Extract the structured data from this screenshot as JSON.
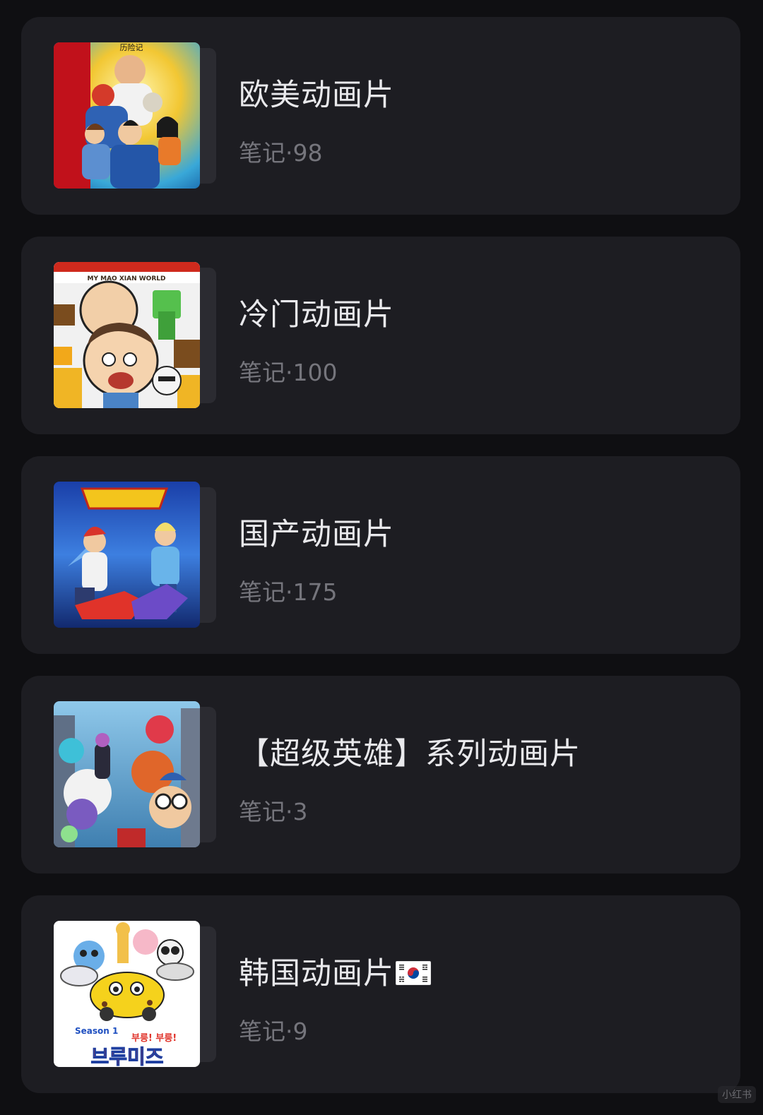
{
  "collections": [
    {
      "title": "欧美动画片",
      "count": "笔记·98",
      "cover_alt": "cover-western"
    },
    {
      "title": "冷门动画片",
      "count": "笔记·100",
      "cover_alt": "cover-niche"
    },
    {
      "title": "国产动画片",
      "count": "笔记·175",
      "cover_alt": "cover-domestic"
    },
    {
      "title": "【超级英雄】系列动画片",
      "count": "笔记·3",
      "cover_alt": "cover-superhero"
    },
    {
      "title": "韩国动画片",
      "count": "笔记·9",
      "cover_alt": "cover-korean"
    }
  ],
  "covers": {
    "cover_1_text": "历险记",
    "cover_2_text": "MY MAO XIAN WORLD",
    "cover_5_season": "Season 1",
    "cover_5_sub": "부릉! 부릉!",
    "cover_5_title": "브루미즈"
  },
  "watermark": "小红书",
  "colors": {
    "background": "#0f0f12",
    "card": "#1d1d22",
    "title": "#e9e9ec",
    "count": "#75757c"
  }
}
